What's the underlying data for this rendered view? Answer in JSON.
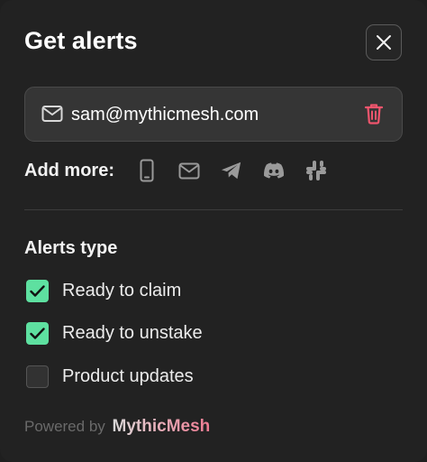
{
  "dialog": {
    "title": "Get alerts",
    "close_icon": "close-icon"
  },
  "email": {
    "address": "sam@mythicmesh.com",
    "icon": "mail-icon",
    "delete_icon": "trash-icon",
    "delete_color": "#f0556d"
  },
  "add_more": {
    "label": "Add more:",
    "channels": [
      {
        "name": "phone",
        "icon": "phone-icon"
      },
      {
        "name": "email",
        "icon": "mail-icon"
      },
      {
        "name": "telegram",
        "icon": "telegram-icon"
      },
      {
        "name": "discord",
        "icon": "discord-icon"
      },
      {
        "name": "slack",
        "icon": "slack-icon"
      }
    ]
  },
  "alerts": {
    "title": "Alerts type",
    "options": [
      {
        "label": "Ready to claim",
        "checked": true
      },
      {
        "label": "Ready to unstake",
        "checked": true
      },
      {
        "label": "Product updates",
        "checked": false
      }
    ],
    "check_color": "#5ee0a0"
  },
  "footer": {
    "powered_by": "Powered by",
    "brand": "MythicMesh"
  }
}
